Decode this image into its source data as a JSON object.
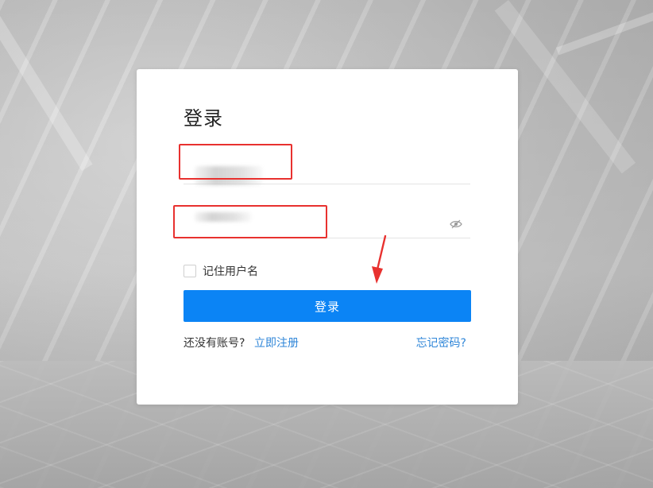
{
  "login": {
    "title": "登录",
    "username": {
      "value": "",
      "placeholder": ""
    },
    "password": {
      "value": "",
      "placeholder": ""
    },
    "remember_label": "记住用户名",
    "remember_checked": false,
    "submit_label": "登录",
    "no_account_text": "还没有账号?",
    "register_link": "立即注册",
    "forgot_link": "忘记密码?"
  },
  "icons": {
    "password_toggle": "eye-hidden-icon",
    "annotation_arrow": "red-arrow-icon"
  },
  "colors": {
    "primary": "#0b84f5",
    "link": "#2f86d8",
    "annotation": "#e8312f"
  }
}
